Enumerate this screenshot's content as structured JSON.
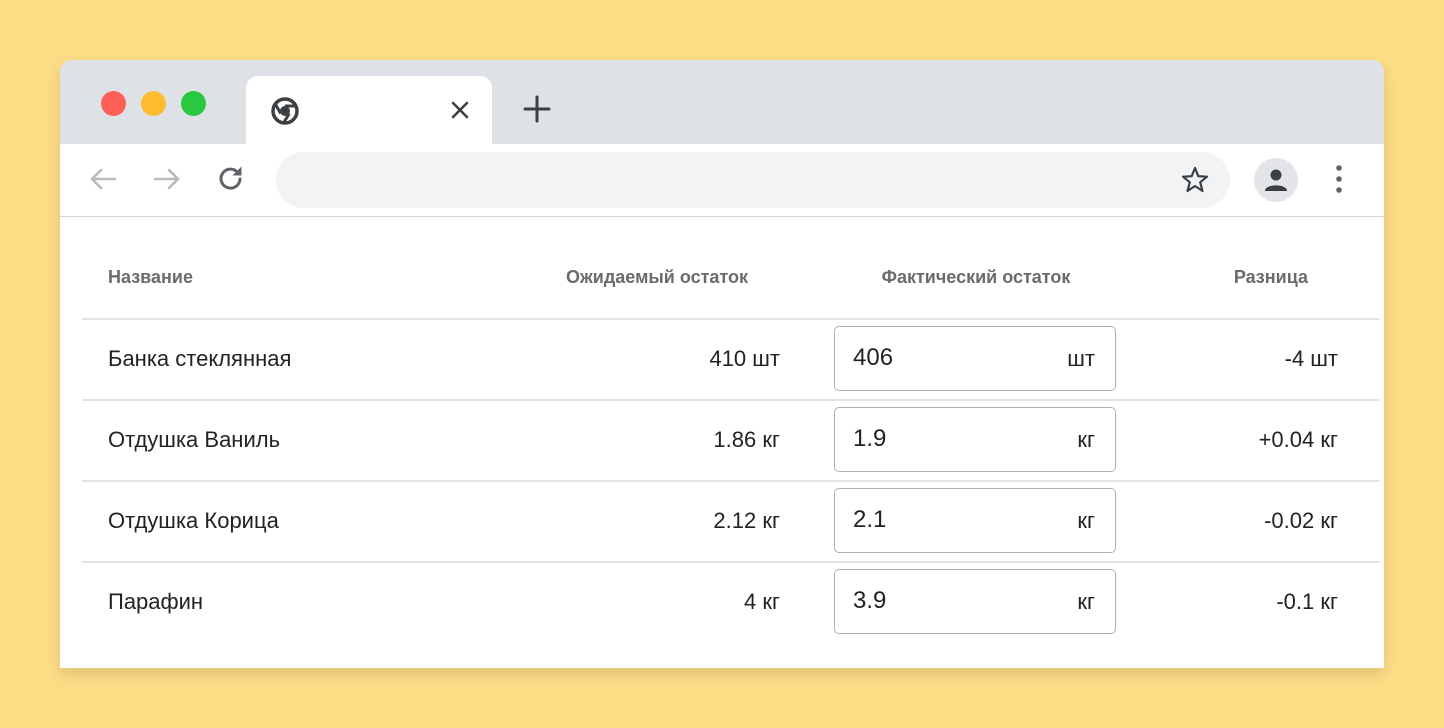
{
  "browser": {
    "tab_title": "",
    "address": "",
    "icons": {
      "favicon": "chrome-icon",
      "tab_close": "close-icon",
      "new_tab": "plus-icon",
      "back": "arrow-left-icon",
      "forward": "arrow-right-icon",
      "reload": "reload-icon",
      "bookmark": "star-icon",
      "profile": "person-icon",
      "menu": "kebab-menu-icon"
    },
    "colors": {
      "window_close": "#FE5F57",
      "window_minimize": "#FEBC2E",
      "window_maximize": "#28C840",
      "page_background": "#FDDC86"
    }
  },
  "table": {
    "headers": {
      "name": "Название",
      "expected": "Ожидаемый остаток",
      "actual": "Фактический остаток",
      "diff": "Разница"
    },
    "rows": [
      {
        "name": "Банка стеклянная",
        "expected": "410 шт",
        "actual_value": "406",
        "actual_unit": "шт",
        "diff": "-4 шт"
      },
      {
        "name": "Отдушка Ваниль",
        "expected": "1.86 кг",
        "actual_value": "1.9",
        "actual_unit": "кг",
        "diff": "+0.04 кг"
      },
      {
        "name": "Отдушка Корица",
        "expected": "2.12 кг",
        "actual_value": "2.1",
        "actual_unit": "кг",
        "diff": "-0.02 кг"
      },
      {
        "name": "Парафин",
        "expected": "4 кг",
        "actual_value": "3.9",
        "actual_unit": "кг",
        "diff": "-0.1 кг"
      }
    ]
  }
}
